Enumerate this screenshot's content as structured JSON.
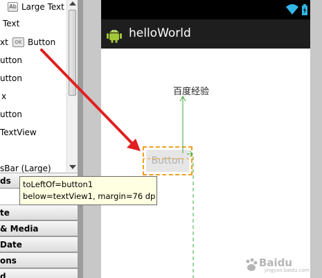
{
  "palette": {
    "items": [
      {
        "label": "Large Text",
        "icon": "Ab"
      },
      {
        "label": "Text"
      },
      {
        "label": "xt",
        "icon": "OK",
        "label2": "Button"
      },
      {
        "label": "utton"
      },
      {
        "label": "utton"
      },
      {
        "label": "x"
      },
      {
        "label": "utton"
      },
      {
        "label": "TextView"
      },
      {
        "label": "sBar (Large)"
      }
    ],
    "categories": [
      {
        "label": "ds"
      },
      {
        "label": "te"
      },
      {
        "label": "& Media"
      },
      {
        "label": "Date"
      },
      {
        "label": "ons"
      },
      {
        "label": "d"
      }
    ]
  },
  "device": {
    "app_title": "helloWorld",
    "text_view": "百度经验",
    "button_label": "Button"
  },
  "tooltip": {
    "line1": "toLeftOf=button1",
    "line2": "below=textView1, margin=76 dp"
  },
  "colors": {
    "accent_arrow": "#e02020",
    "selection": "#f0a020",
    "guide": "#3aa83a",
    "wifi": "#33b5e5",
    "battery": "#33b5e5",
    "android": "#a4c639"
  },
  "watermark": {
    "brand": "Baidu",
    "sub": "jingyan.baidu.com"
  }
}
